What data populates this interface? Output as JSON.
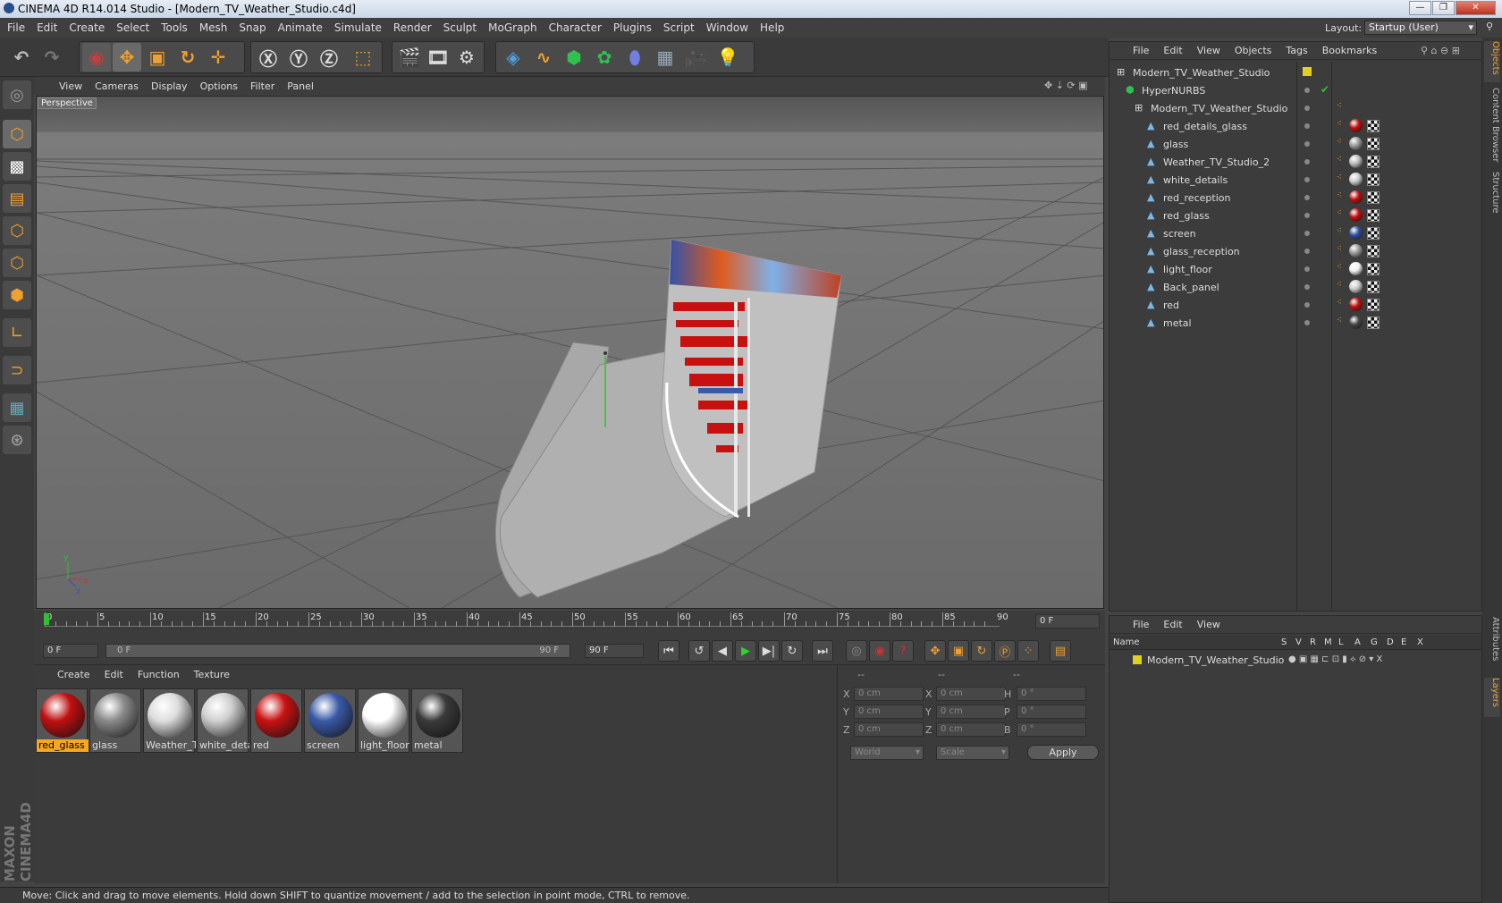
{
  "window": {
    "title": "CINEMA 4D R14.014 Studio - [Modern_TV_Weather_Studio.c4d]"
  },
  "menu": [
    "File",
    "Edit",
    "Create",
    "Select",
    "Tools",
    "Mesh",
    "Snap",
    "Animate",
    "Simulate",
    "Render",
    "Sculpt",
    "MoGraph",
    "Character",
    "Plugins",
    "Script",
    "Window",
    "Help"
  ],
  "layout": {
    "label": "Layout:",
    "value": "Startup (User)"
  },
  "viewport": {
    "menu": [
      "View",
      "Cameras",
      "Display",
      "Options",
      "Filter",
      "Panel"
    ],
    "label": "Perspective"
  },
  "objects": {
    "menu": [
      "File",
      "Edit",
      "View",
      "Objects",
      "Tags",
      "Bookmarks"
    ],
    "rows": [
      {
        "name": "Modern_TV_Weather_Studio",
        "level": 0
      },
      {
        "name": "HyperNURBS",
        "level": 1
      },
      {
        "name": "Modern_TV_Weather_Studio",
        "level": 2
      },
      {
        "name": "red_details_glass",
        "level": 3,
        "mat": "#c01010"
      },
      {
        "name": "glass",
        "level": 3,
        "mat": "#999999"
      },
      {
        "name": "Weather_TV_Studio_2",
        "level": 3,
        "mat": "#bbbbbb"
      },
      {
        "name": "white_details",
        "level": 3,
        "mat": "#cccccc"
      },
      {
        "name": " red_reception",
        "level": 3,
        "mat": "#c01010"
      },
      {
        "name": "red_glass",
        "level": 3,
        "mat": "#c01010"
      },
      {
        "name": "screen",
        "level": 3,
        "mat": "#3050a0"
      },
      {
        "name": "glass_reception",
        "level": 3,
        "mat": "#999999"
      },
      {
        "name": "light_floor",
        "level": 3,
        "mat": "#f0f0f0"
      },
      {
        "name": "Back_panel",
        "level": 3,
        "mat": "#cccccc"
      },
      {
        "name": "red",
        "level": 3,
        "mat": "#c01010"
      },
      {
        "name": "metal",
        "level": 3,
        "mat": "#444444"
      }
    ]
  },
  "timeline": {
    "ticks": [
      "0",
      "5",
      "10",
      "15",
      "20",
      "25",
      "30",
      "35",
      "40",
      "45",
      "50",
      "55",
      "60",
      "65",
      "70",
      "75",
      "80",
      "85",
      "90"
    ],
    "current_frame": "0 F",
    "start_field": "0 F",
    "range_start": "0 F",
    "range_end": "90 F",
    "end_field": "90 F"
  },
  "materials": {
    "menu": [
      "Create",
      "Edit",
      "Function",
      "Texture"
    ],
    "items": [
      {
        "name": "red_glass",
        "color": "#c01010",
        "selected": true
      },
      {
        "name": "glass",
        "color": "#8a8a8a",
        "selected": false
      },
      {
        "name": "Weather_T",
        "color": "#dddddd",
        "selected": false
      },
      {
        "name": "white_deta",
        "color": "#cfcfcf",
        "selected": false
      },
      {
        "name": "red",
        "color": "#c81212",
        "selected": false
      },
      {
        "name": "screen",
        "color": "#3a5aa8",
        "selected": false
      },
      {
        "name": "light_floor",
        "color": "#ffffff",
        "selected": false
      },
      {
        "name": "metal",
        "color": "#3a3a3a",
        "selected": false
      }
    ]
  },
  "coords": {
    "headers": [
      "--",
      "--",
      "--"
    ],
    "rows": [
      {
        "a": "X",
        "av": "0 cm",
        "b": "X",
        "bv": "0 cm",
        "c": "H",
        "cv": "0 °"
      },
      {
        "a": "Y",
        "av": "0 cm",
        "b": "Y",
        "bv": "0 cm",
        "c": "P",
        "cv": "0 °"
      },
      {
        "a": "Z",
        "av": "0 cm",
        "b": "Z",
        "bv": "0 cm",
        "c": "B",
        "cv": "0 °"
      }
    ],
    "world": "World",
    "scale": "Scale",
    "apply": "Apply"
  },
  "attributes": {
    "menu": [
      "File",
      "Edit",
      "View"
    ],
    "columns": [
      "Name",
      "S",
      "V",
      "R",
      "M",
      "L",
      "A",
      "G",
      "D",
      "E",
      "X"
    ],
    "row": "Modern_TV_Weather_Studio"
  },
  "side_tabs": [
    "Objects",
    "Content Browser",
    "Structure",
    "Attributes",
    "Layers"
  ],
  "brand": "MAXON CINEMA4D",
  "status": "Move: Click and drag to move elements. Hold down SHIFT to quantize movement / add to the selection in point mode, CTRL to remove.",
  "colors": {
    "accent": "#f0a030",
    "selected": "#f5a623",
    "axis_y": "#30c030",
    "axis_x": "#d03030"
  }
}
